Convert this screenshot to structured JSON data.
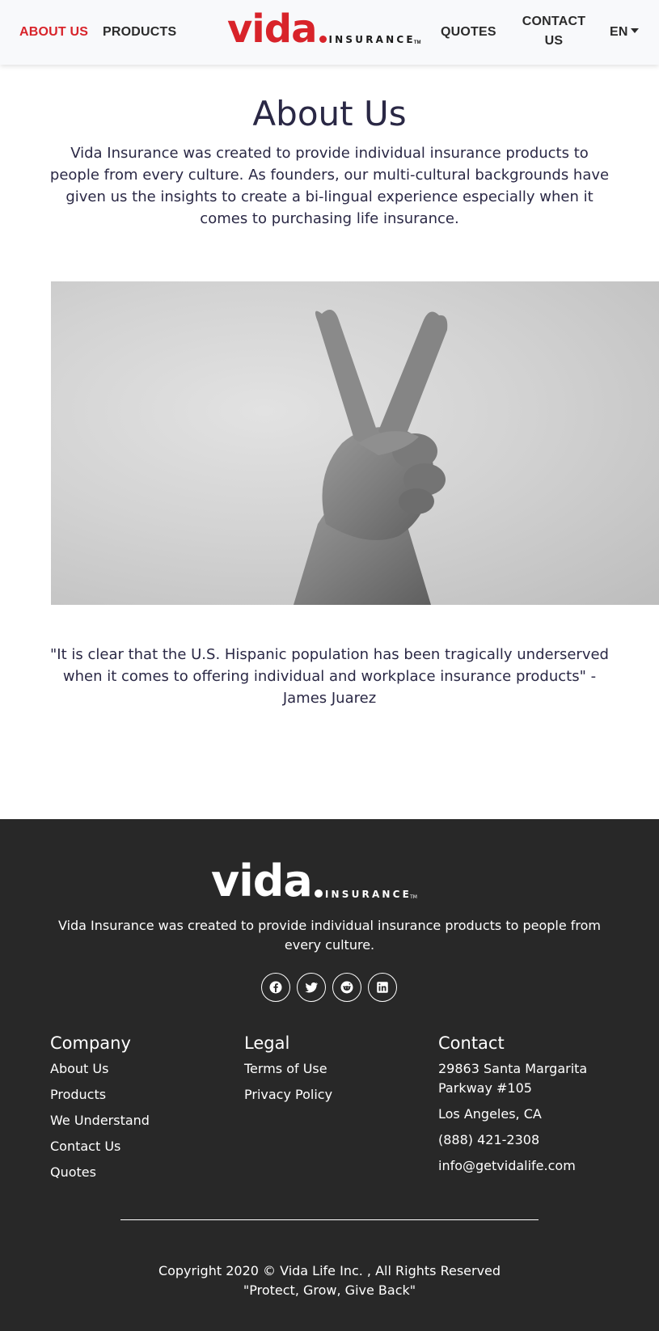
{
  "header": {
    "nav_left": [
      "ABOUT US",
      "PRODUCTS"
    ],
    "nav_right": [
      "QUOTES",
      "CONTACT US"
    ],
    "language": "EN",
    "logo": {
      "word": "vida",
      "sub": "INSURANCE",
      "tm": "TM"
    }
  },
  "main": {
    "title": "About Us",
    "intro": "Vida Insurance was created to provide individual insurance products to people from every culture. As founders, our multi-cultural backgrounds have given us the insights to create a bi-lingual experience especially when it comes to purchasing life insurance.",
    "quote": "\"It is clear that the U.S. Hispanic population has been tragically underserved when it comes to offering individual and workplace insurance products\" - James Juarez"
  },
  "footer": {
    "logo": {
      "word": "vida",
      "sub": "INSURANCE",
      "tm": "TM"
    },
    "tagline": "Vida Insurance was created to provide individual insurance products to people from every culture.",
    "social": [
      "facebook-icon",
      "twitter-icon",
      "reddit-icon",
      "linkedin-icon"
    ],
    "company": {
      "heading": "Company",
      "links": [
        "About Us",
        "Products",
        "We Understand",
        "Contact Us",
        "Quotes"
      ]
    },
    "legal": {
      "heading": "Legal",
      "links": [
        "Terms of Use",
        "Privacy Policy"
      ]
    },
    "contact": {
      "heading": "Contact",
      "address": "29863 Santa Margarita Parkway #105",
      "city": "Los Angeles, CA",
      "phone": "(888) 421-2308",
      "email": "info@getvidalife.com"
    },
    "copyright": "Copyright 2020 © Vida Life Inc. , All Rights Reserved",
    "motto": "\"Protect, Grow, Give Back\""
  },
  "colors": {
    "accent": "#d8232a",
    "text": "#2a2845",
    "footer_bg": "#282828",
    "header_bg": "#f8f9fb"
  }
}
